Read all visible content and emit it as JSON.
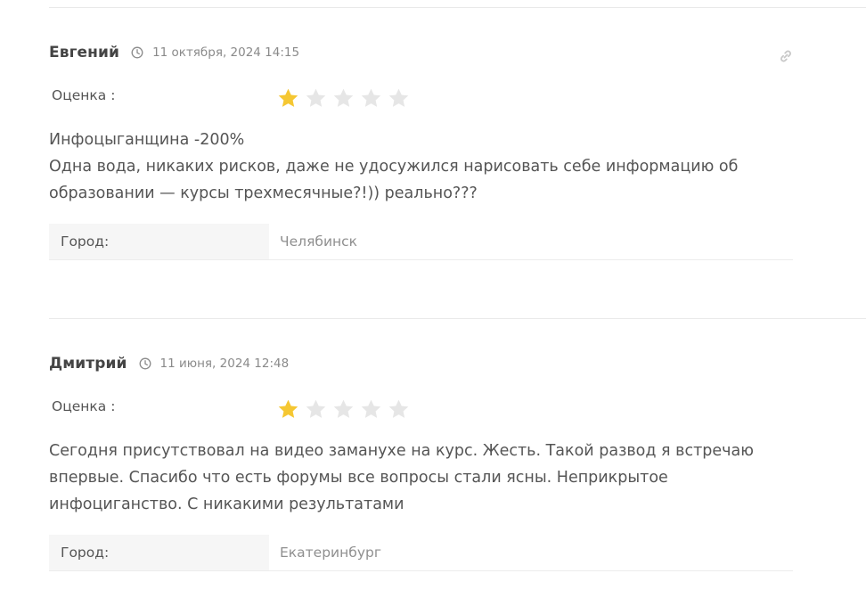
{
  "reviews": [
    {
      "author": "Евгений",
      "date": "11 октября, 2024 14:15",
      "rating_label": "Оценка :",
      "rating": 1,
      "rating_max": 5,
      "text_lines": [
        "Инфоцыганщина -200%",
        "Одна вода, никаких рисков, даже не удосужился нарисовать себе информацию об",
        "образовании — курсы трехмесячные?!)) реально???"
      ],
      "city_label": "Город:",
      "city_value": "Челябинск"
    },
    {
      "author": "Дмитрий",
      "date": "11 июня, 2024 12:48",
      "rating_label": "Оценка :",
      "rating": 1,
      "rating_max": 5,
      "text_lines": [
        "Сегодня присутствовал на видео заманухе на курс. Жесть. Такой развод я встречаю",
        "впервые. Спасибо что есть форумы все вопросы стали ясны. Неприкрытое",
        "инфоциганство. С никакими результатами"
      ],
      "city_label": "Город:",
      "city_value": "Екатеринбург"
    }
  ],
  "icons": {
    "clock": "clock-icon",
    "link": "link-icon",
    "star_filled": "star-filled-icon",
    "star_empty": "star-empty-icon"
  },
  "colors": {
    "star_filled": "#f5c732",
    "star_empty": "#e6e6e6",
    "divider": "#e9e9e9",
    "city_label_bg": "#f6f6f6"
  }
}
